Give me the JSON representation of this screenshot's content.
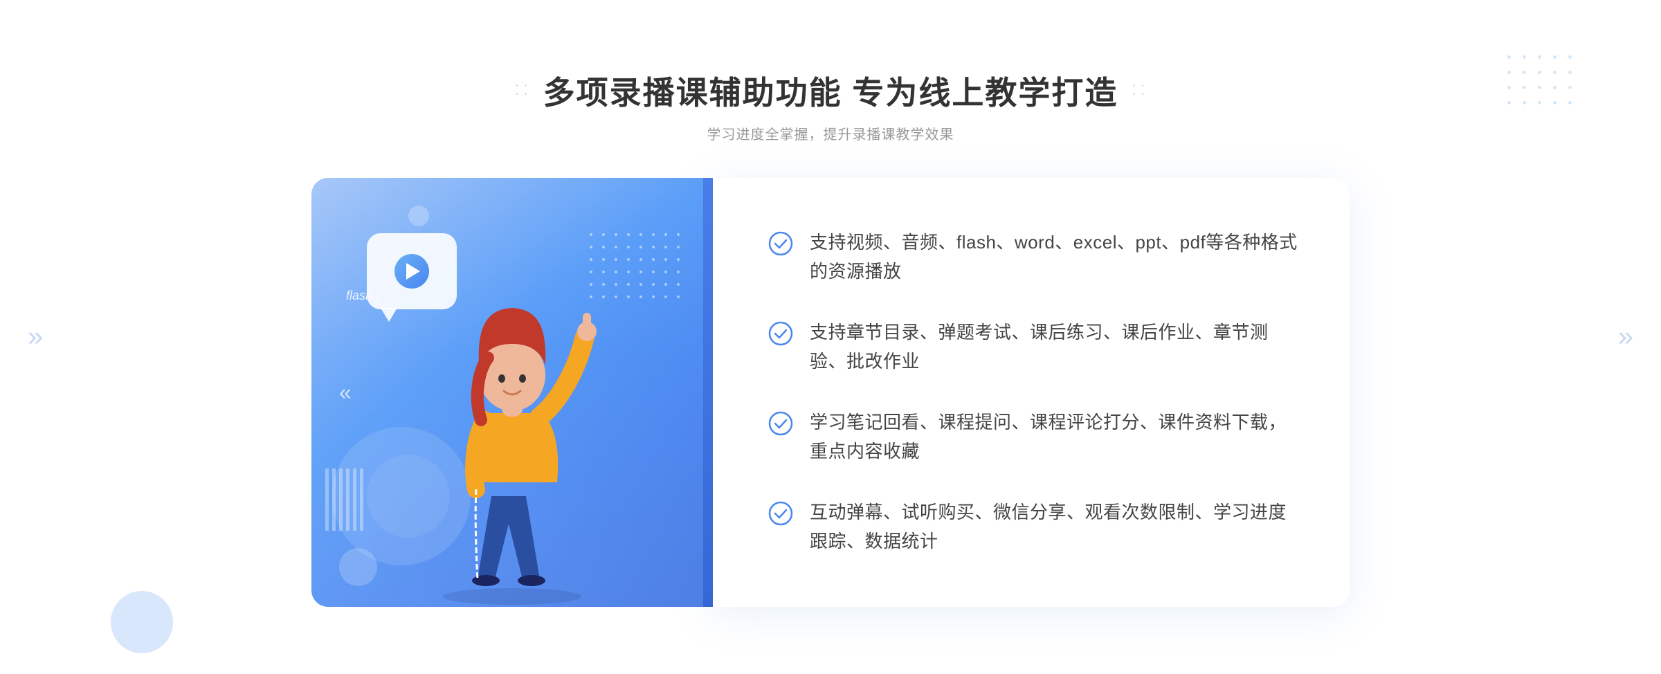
{
  "header": {
    "title": "多项录播课辅助功能 专为线上教学打造",
    "subtitle": "学习进度全掌握，提升录播课教学效果",
    "dots_left": "⁚⁚",
    "dots_right": "⁚⁚"
  },
  "features": [
    {
      "id": 1,
      "text": "支持视频、音频、flash、word、excel、ppt、pdf等各种格式的资源播放"
    },
    {
      "id": 2,
      "text": "支持章节目录、弹题考试、课后练习、课后作业、章节测验、批改作业"
    },
    {
      "id": 3,
      "text": "学习笔记回看、课程提问、课程评论打分、课件资料下载，重点内容收藏"
    },
    {
      "id": 4,
      "text": "互动弹幕、试听购买、微信分享、观看次数限制、学习进度跟踪、数据统计"
    }
  ],
  "illustration": {
    "flash_label": "flash ,"
  },
  "colors": {
    "primary_blue": "#4a86f0",
    "light_blue": "#a8c8f8",
    "check_color": "#4a86f0",
    "title_color": "#333333",
    "text_color": "#444444",
    "subtitle_color": "#999999"
  }
}
